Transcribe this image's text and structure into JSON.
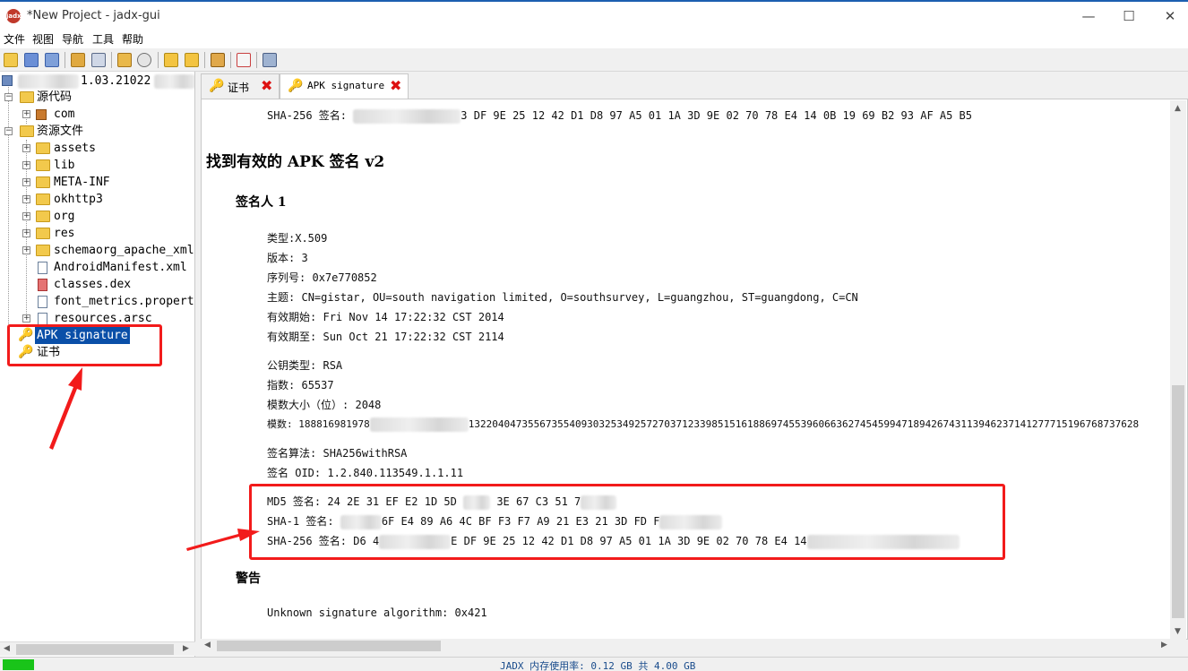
{
  "window": {
    "title": "*New Project - jadx-gui",
    "logo_text": "jadx",
    "controls": {
      "minimize": "—",
      "maximize": "☐",
      "close": "✕"
    }
  },
  "menu": [
    "文件",
    "视图",
    "导航",
    "工具",
    "帮助"
  ],
  "toolbar": {
    "icons": [
      "open-icon",
      "add-files-icon",
      "save-all-icon",
      "sync-icon",
      "flat-packages-icon",
      "decompile-icon",
      "search-icon",
      "back-icon",
      "forward-icon",
      "export-icon",
      "log-icon",
      "settings-icon"
    ]
  },
  "tree": {
    "root_label": "1.03.21022",
    "items": [
      {
        "label": "源代码"
      },
      {
        "label": "com"
      },
      {
        "label": "资源文件"
      },
      {
        "label": "assets"
      },
      {
        "label": "lib"
      },
      {
        "label": "META-INF"
      },
      {
        "label": "okhttp3"
      },
      {
        "label": "org"
      },
      {
        "label": "res"
      },
      {
        "label": "schemaorg_apache_xml"
      },
      {
        "label": "AndroidManifest.xml"
      },
      {
        "label": "classes.dex"
      },
      {
        "label": "font_metrics.propert"
      },
      {
        "label": "resources.arsc"
      },
      {
        "label": "APK signature"
      },
      {
        "label": "证书"
      }
    ]
  },
  "tabs": [
    {
      "label": "证书",
      "close": "✖"
    },
    {
      "label": "APK signature",
      "close": "✖"
    }
  ],
  "content": {
    "top_sha256_label": "SHA-256 签名:",
    "top_sha256_value": "3 DF 9E 25 12 42 D1 D8 97 A5 01 1A 3D 9E 02 70 78 E4 14 0B 19 69 B2 93 AF A5 B5",
    "heading_v2": "找到有效的 APK 签名 v2",
    "signer_heading": "签名人 1",
    "type_label": "类型:",
    "type_value": "X.509",
    "version_label": "版本:",
    "version_value": "3",
    "serial_label": "序列号:",
    "serial_value": "0x7e770852",
    "subject_label": "主题:",
    "subject_value": "CN=gistar, OU=south navigation limited, O=southsurvey, L=guangzhou, ST=guangdong, C=CN",
    "valid_from_label": "有效期始:",
    "valid_from_value": "Fri Nov 14 17:22:32 CST 2014",
    "valid_to_label": "有效期至:",
    "valid_to_value": "Sun Oct 21 17:22:32 CST 2114",
    "pubkey_type_label": "公钥类型:",
    "pubkey_type_value": "RSA",
    "exponent_label": "指数:",
    "exponent_value": "65537",
    "modulus_size_label": "模数大小（位）:",
    "modulus_size_value": "2048",
    "modulus_label": "模数:",
    "modulus_value_a": "188816981978",
    "modulus_value_b": "13220404735567355409303253492572703712339851516188697455396066362745459947189426743113946237141277715196768737628",
    "sig_alg_label": "签名算法:",
    "sig_alg_value": "SHA256withRSA",
    "sig_oid_label": "签名 OID:",
    "sig_oid_value": "1.2.840.113549.1.1.11",
    "md5_label": "MD5 签名:",
    "md5_value": "24 2E 31 EF E2 1D 5D",
    "md5_value_b": "3E 67 C3 51 7",
    "sha1_label": "SHA-1 签名:",
    "sha1_value": "6F E4 89 A6 4C BF F3 F7 A9 21 E3 21 3D FD F",
    "sha256_label": "SHA-256 签名:",
    "sha256_value_a": "D6 4",
    "sha256_value_b": "E DF 9E 25 12 42 D1 D8 97 A5 01 1A 3D 9E 02 70 78 E4 14",
    "warning_heading": "警告",
    "warning_text": "Unknown signature algorithm: 0x421"
  },
  "statusbar": {
    "memory_text": "JADX 内存使用率: 0.12 GB 共 4.00 GB",
    "memory_fraction": 0.03
  },
  "colors": {
    "selection": "#0a4fa8",
    "annotation_red": "#f21b1b",
    "memory_green": "#19c419",
    "close_red": "#d11111"
  }
}
